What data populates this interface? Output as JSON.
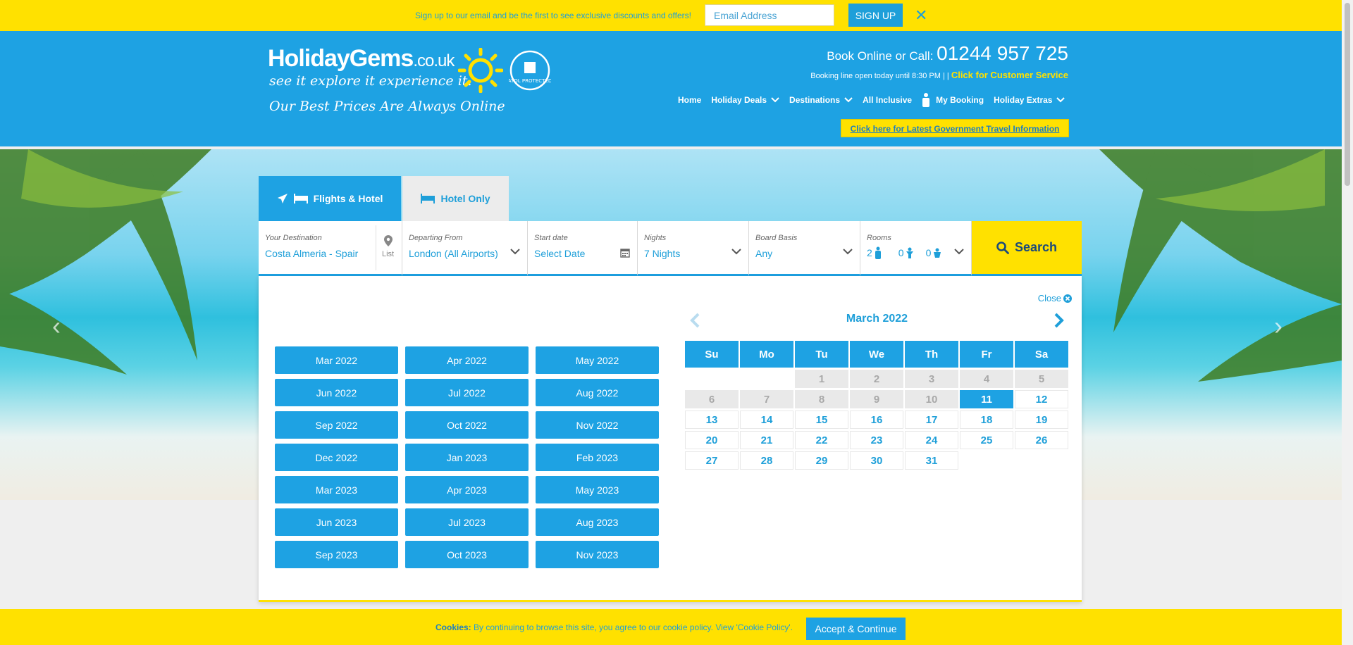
{
  "promo": {
    "text": "Sign up to our email and be the first to see exclusive discounts and offers!",
    "email_placeholder": "Email Address",
    "signup_label": "SIGN UP",
    "close_label": "✕"
  },
  "header": {
    "logo_main": "HolidayGems",
    "logo_tld": ".co.uk",
    "logo_tagline": "see it  explore it  experience it.",
    "logo_prices": "Our Best Prices Are Always Online",
    "atol_text": "ATOL PROTECTED",
    "call_label": "Book Online or Call: ",
    "call_number": "01244 957 725",
    "booking_line": "Booking line open today until 8:30 PM | | ",
    "customer_service": "Click for Customer Service",
    "gov_info": "Click here for Latest Government Travel Information"
  },
  "nav": {
    "items": [
      {
        "label": "Home",
        "dropdown": false
      },
      {
        "label": "Holiday Deals",
        "dropdown": true
      },
      {
        "label": "Destinations",
        "dropdown": true
      },
      {
        "label": "All Inclusive",
        "dropdown": false
      },
      {
        "label": "My Booking",
        "dropdown": false
      },
      {
        "label": "Holiday Extras",
        "dropdown": true
      }
    ]
  },
  "search": {
    "tabs": [
      {
        "label": "Flights & Hotel",
        "active": true
      },
      {
        "label": "Hotel Only",
        "active": false
      }
    ],
    "destination": {
      "label": "Your Destination",
      "value": "Costa Almeria - Spair",
      "list_label": "List"
    },
    "departing": {
      "label": "Departing From",
      "value": "London (All Airports)"
    },
    "start_date": {
      "label": "Start date",
      "value": "Select Date"
    },
    "nights": {
      "label": "Nights",
      "value": "7 Nights"
    },
    "board": {
      "label": "Board Basis",
      "value": "Any"
    },
    "rooms": {
      "label": "Rooms",
      "adults": "2",
      "children": "0",
      "infants": "0"
    },
    "search_label": "Search"
  },
  "date_panel": {
    "close_label": "Close",
    "months": [
      "Mar 2022",
      "Apr 2022",
      "May 2022",
      "Jun 2022",
      "Jul 2022",
      "Aug 2022",
      "Sep 2022",
      "Oct 2022",
      "Nov 2022",
      "Dec 2022",
      "Jan 2023",
      "Feb 2023",
      "Mar 2023",
      "Apr 2023",
      "May 2023",
      "Jun 2023",
      "Jul 2023",
      "Aug 2023",
      "Sep 2023",
      "Oct 2023",
      "Nov 2023"
    ],
    "calendar": {
      "title": "March 2022",
      "weekdays": [
        "Su",
        "Mo",
        "Tu",
        "We",
        "Th",
        "Fr",
        "Sa"
      ],
      "leading_blanks": 2,
      "days_in_month": 31,
      "past_until": 10,
      "selected_day": 11
    }
  },
  "cookie": {
    "label": "Cookies:",
    "text": " By continuing to browse this site, you agree to our cookie policy. View 'Cookie Policy'.",
    "accept_label": "Accept & Continue"
  },
  "colors": {
    "brand_blue": "#1ea2e3",
    "brand_yellow": "#ffe100"
  }
}
